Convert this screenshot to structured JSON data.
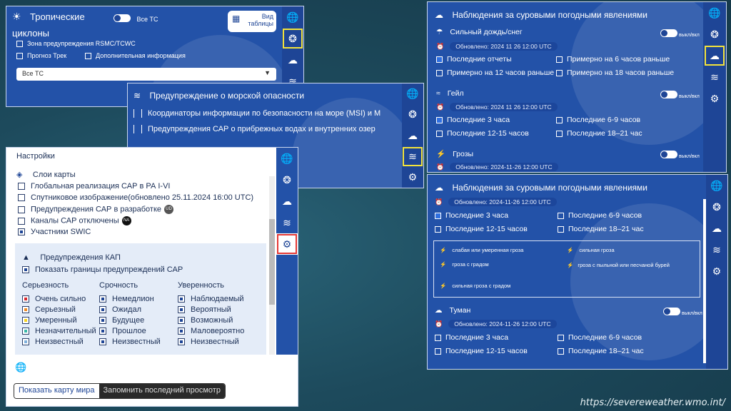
{
  "url_caption": "https://severeweather.wmo.int/",
  "tc_panel": {
    "title_line1": "Тропические",
    "title_line2": "циклоны",
    "toggle_label": "Все ТС",
    "view_btn_line1": "Вид",
    "view_btn_line2": "таблицы",
    "checkbox1": "Зона предупреждения RSMC/TCWC",
    "checkbox2": "Прогноз Трек",
    "checkbox3": "Дополнительная информация",
    "select_value": "Все ТС"
  },
  "marine_panel": {
    "title": "Предупреждение о морской опасности",
    "item1": "Координаторы информации по безопасности на море (MSI) и М",
    "item2": "Предупреждения САР о прибрежных водах и внутренних озер"
  },
  "settings_panel": {
    "title": "Настройки",
    "map_layers": "Слои карты",
    "layers": [
      {
        "label": "Глобальная реализация САР в РА I-VI",
        "badge": ""
      },
      {
        "label": "Спутниковое изображение(обновлено 25.11.2024 16:00 UTC)",
        "badge": ""
      },
      {
        "label": "Предупреждения САР в разработке",
        "badge": "UD"
      },
      {
        "label": "Каналы САР отключены",
        "badge": "NA"
      },
      {
        "label": "Участники SWIC",
        "badge": ""
      }
    ],
    "cap_title": "Предупреждения КАП",
    "cap_show_bounds": "Показать границы предупреждений САР",
    "col_headers": [
      "Серьезность",
      "Срочность",
      "Уверенность"
    ],
    "severity": [
      {
        "label": "Очень сильно",
        "color": "#d9282f"
      },
      {
        "label": "Серьезный",
        "color": "#f08a24"
      },
      {
        "label": "Умеренный",
        "color": "#f6d21e"
      },
      {
        "label": "Незначительный",
        "color": "#39b7a9"
      },
      {
        "label": "Неизвестный",
        "color": "#7fb0dc"
      }
    ],
    "urgency": [
      "Немедлион",
      "Ожидал",
      "Будущее",
      "Прошлое",
      "Неизвестный"
    ],
    "certainty": [
      "Наблюдаемый",
      "Вероятный",
      "Возможный",
      "Маловероятно",
      "Неизвестный"
    ],
    "btn_world": "Показать карту мира",
    "btn_remember": "Запомнить последний просмотр"
  },
  "severe_panel_top": {
    "title": "Наблюдения за суровыми погодными явлениями",
    "rain_title": "Сильный дождь/снег",
    "updated_rain": "Обновлено: 2024 11 26 12:00 UTC",
    "rain_opts": [
      "Последние отчеты",
      "Примерно на 6 часов раньше",
      "Примерно на 12 часов раньше",
      "Примерно на 18 часов раньше"
    ],
    "gale_title": "Гейл",
    "updated_gale": "Обновлено: 2024 11 26 12:00 UTC",
    "gale_opts": [
      "Последние 3 часа",
      "Последние 6-9 часов",
      "Последние 12-15 часов",
      "Последние 18–21 час"
    ],
    "storm_title": "Грозы",
    "updated_storm": "Обновлено: 2024-11-26 12:00 UTC",
    "toggle_label": "выкл/вкл"
  },
  "severe_panel_bottom": {
    "title": "Наблюдения за суровыми погодными явлениями",
    "updated": "Обновлено: 2024-11-26 12:00 UTC",
    "opts": [
      "Последние 3 часа",
      "Последние 6-9 часов",
      "Последние 12-15 часов",
      "Последние 18–21 час"
    ],
    "legend": [
      "слабая или умеренная гроза",
      "сильная гроза",
      "гроза с градом",
      "гроза с пыльной или песчаной бурей",
      "сильная гроза с градом"
    ],
    "fog_title": "Туман",
    "fog_updated": "Обновлено: 2024-11-26 12:00 UTC",
    "fog_opts": [
      "Последние 3 часа",
      "Последние 6-9 часов",
      "Последние 12-15 часов",
      "Последние 18–21 час"
    ],
    "toggle_label": "выкл/вкл"
  }
}
